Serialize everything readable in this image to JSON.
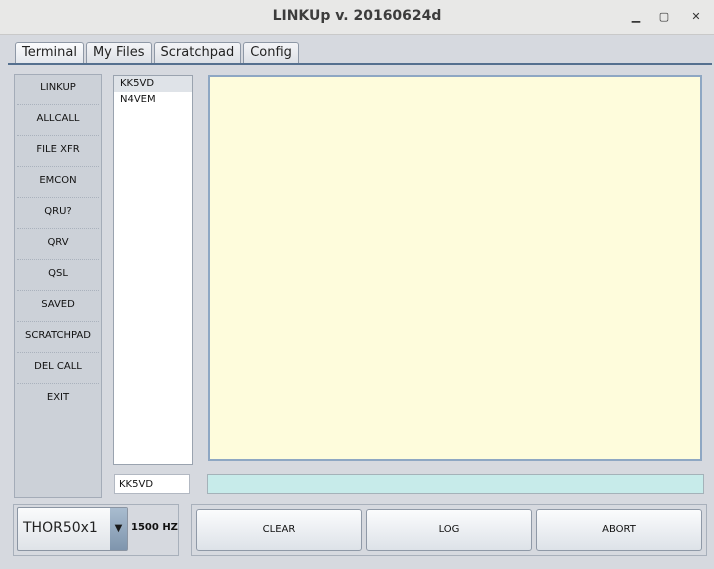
{
  "window": {
    "title": "LINKUp v. 20160624d",
    "minimize": "▁",
    "maximize": "▢",
    "close": "✕"
  },
  "tabs": [
    {
      "label": "Terminal"
    },
    {
      "label": "My Files"
    },
    {
      "label": "Scratchpad"
    },
    {
      "label": "Config"
    }
  ],
  "commands": [
    {
      "label": "LINKUP"
    },
    {
      "label": "ALLCALL"
    },
    {
      "label": "FILE XFR"
    },
    {
      "label": "EMCON"
    },
    {
      "label": "QRU?"
    },
    {
      "label": "QRV"
    },
    {
      "label": "QSL"
    },
    {
      "label": "SAVED"
    },
    {
      "label": "SCRATCHPAD"
    },
    {
      "label": "DEL CALL"
    },
    {
      "label": "EXIT"
    }
  ],
  "calls": [
    {
      "label": "KK5VD"
    },
    {
      "label": "N4VEM"
    }
  ],
  "selected_call": "KK5VD",
  "mode": {
    "value": "THOR50x1",
    "frequency": "1500 HZ"
  },
  "actions": {
    "clear": "CLEAR",
    "log": "LOG",
    "abort": "ABORT"
  },
  "colors": {
    "text_area_bg": "#fefcdc",
    "input_line_bg": "#c7ebea",
    "tab_underline": "#55708f"
  }
}
